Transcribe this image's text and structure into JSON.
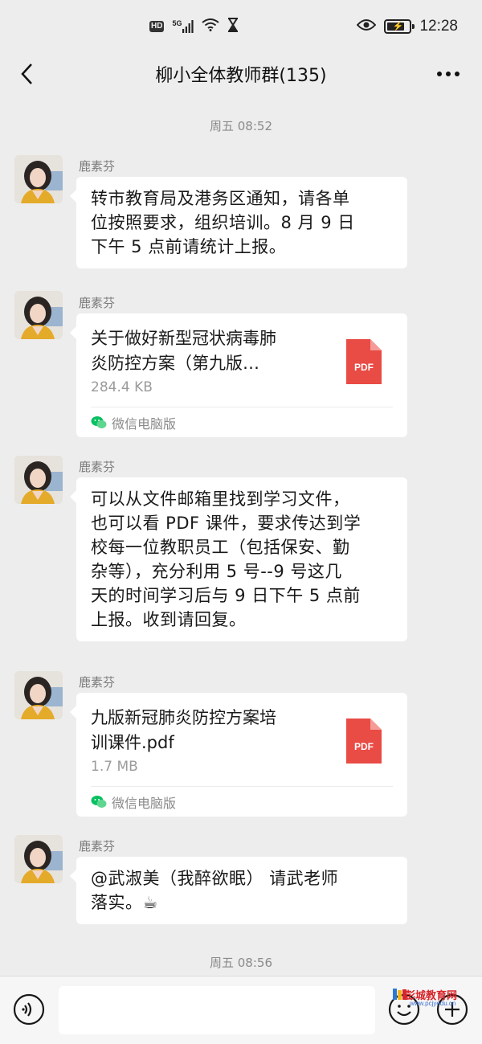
{
  "status_bar": {
    "hd": "HD",
    "network": "5G",
    "time": "12:28",
    "battery_level": 0.8
  },
  "header": {
    "title": "柳小全体教师群(135)"
  },
  "timestamps": [
    "周五 08:52",
    "周五 08:56"
  ],
  "messages": [
    {
      "sender": "鹿素芬",
      "type": "text",
      "lines": [
        "转市教育局及港务区通知，请各单",
        "位按照要求，组织培训。8 月 9 日",
        "下午 5 点前请统计上报。"
      ]
    },
    {
      "sender": "鹿素芬",
      "type": "file",
      "name_lines": [
        "关于做好新型冠状病毒肺",
        "炎防控方案（第九版…"
      ],
      "size": "284.4 KB",
      "file_type": "PDF",
      "source": "微信电脑版"
    },
    {
      "sender": "鹿素芬",
      "type": "text",
      "lines": [
        "可以从文件邮箱里找到学习文件，",
        "也可以看 PDF 课件，要求传达到学",
        "校每一位教职员工（包括保安、勤",
        "杂等），充分利用 5 号--9 号这几",
        "天的时间学习后与 9 日下午 5 点前",
        "上报。收到请回复。"
      ]
    },
    {
      "sender": "鹿素芬",
      "type": "file",
      "name_lines": [
        "九版新冠肺炎防控方案培",
        "训课件.pdf"
      ],
      "size": "1.7 MB",
      "file_type": "PDF",
      "source": "微信电脑版"
    },
    {
      "sender": "鹿素芬",
      "type": "text",
      "lines": [
        "@武淑美（我醉欲眠） 请武老师",
        "落实。☕"
      ]
    }
  ],
  "watermark": {
    "title": "彭城教育网",
    "url": "www.pcjyedu.cn"
  },
  "colors": {
    "background": "#ededed",
    "bubble": "#ffffff",
    "pdf_red": "#e94b45",
    "wechat_green": "#07c160"
  }
}
